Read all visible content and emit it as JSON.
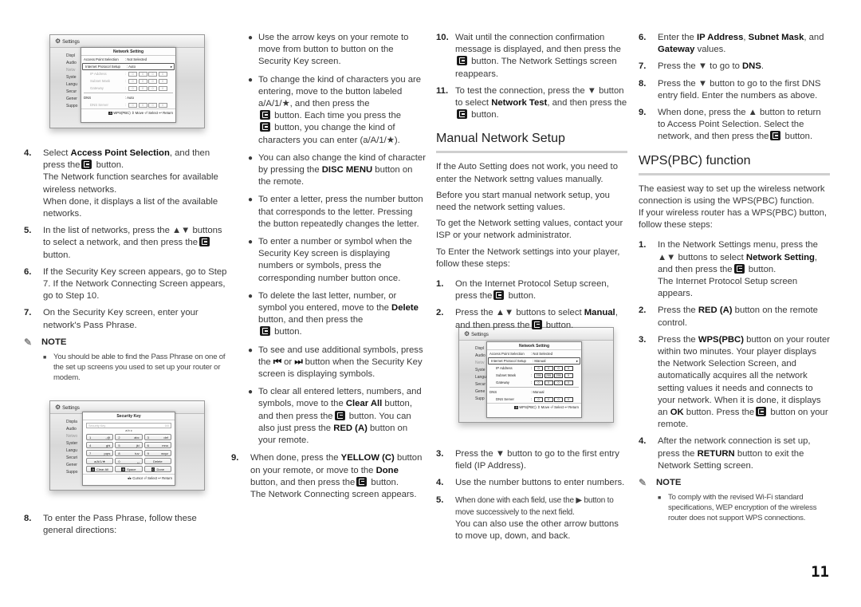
{
  "page_number": "11",
  "enter_icon": "enter-button-icon",
  "screen1": {
    "header": "Settings",
    "sidebar": [
      "Displ",
      "Audio",
      "Netw",
      "Syste",
      "Langu",
      "Secur",
      "Gener",
      "Suppo"
    ],
    "popup_title": "Network Setting",
    "rows": [
      {
        "label": "Access Point Selection",
        "value": ": Not Selected"
      },
      {
        "label": "Internet Protocol Setup",
        "value": ": Auto"
      }
    ],
    "ip_fields": [
      {
        "label": "IP Address",
        "cells": [
          "0",
          "0",
          "0",
          "0"
        ]
      },
      {
        "label": "Subnet Mask",
        "cells": [
          "0",
          "0",
          "0",
          "0"
        ]
      },
      {
        "label": "Gateway",
        "cells": [
          "0",
          "0",
          "0",
          "0"
        ]
      }
    ],
    "dns_label": "DNS",
    "dns_value": ": Auto",
    "dns_server": {
      "label": "DNS Server",
      "cells": [
        "0",
        "0",
        "0",
        "0"
      ]
    },
    "footer": {
      "key": "A",
      "text": "WPS(PBC)  ⇕ Move  ⏎ Select  ↩ Return"
    }
  },
  "screen2": {
    "header": "Settings",
    "sidebar": [
      "Displa",
      "Audio",
      "Netwo",
      "Syster",
      "Langu",
      "Securi",
      "Gener",
      "Suppo"
    ],
    "popup_title": "Security Key",
    "input_placeholder": "Security Key",
    "input_counter": "0/0",
    "charset": "a  b  c",
    "keys": [
      {
        "num": "1",
        "chars": ".,@"
      },
      {
        "num": "2",
        "chars": "abc"
      },
      {
        "num": "3",
        "chars": "def"
      },
      {
        "num": "4",
        "chars": "ghi"
      },
      {
        "num": "5",
        "chars": "jkl"
      },
      {
        "num": "6",
        "chars": "mno"
      },
      {
        "num": "7",
        "chars": "pqrs"
      },
      {
        "num": "8",
        "chars": "tuv"
      },
      {
        "num": "9",
        "chars": "wxyz"
      },
      {
        "num": "",
        "chars": "a/A/1/★"
      },
      {
        "num": "0",
        "chars": "␣"
      },
      {
        "num": "",
        "chars": "Delete"
      },
      {
        "num": "A",
        "chars": "Clear All"
      },
      {
        "num": "B",
        "chars": "Space"
      },
      {
        "num": "C",
        "chars": "Done"
      }
    ],
    "footer": "◂/▸ Cursor  ⏎ Select  ↩ Return"
  },
  "screen3": {
    "header": "Settings",
    "sidebar": [
      "Displ",
      "Audio",
      "Netw",
      "Syste",
      "Langu",
      "Secur",
      "Gene",
      "Supp"
    ],
    "popup_title": "Network Setting",
    "rows": [
      {
        "label": "Access Point Selection",
        "value": ": Not Selected"
      },
      {
        "label": "Internet Protocol Setup",
        "value": ": Manual"
      }
    ],
    "ip_fields": [
      {
        "label": "IP Address",
        "cells": [
          "0",
          "0",
          "0",
          "0"
        ]
      },
      {
        "label": "Subnet Mask",
        "cells": [
          "255",
          "255",
          "255",
          "0"
        ]
      },
      {
        "label": "Gateway",
        "cells": [
          "0",
          "0",
          "0",
          "0"
        ]
      }
    ],
    "dns_label": "DNS",
    "dns_value": ": Manual",
    "dns_server": {
      "label": "DNS Server",
      "cells": [
        "0",
        "0",
        "0",
        "0"
      ]
    },
    "footer": {
      "key": "A",
      "text": "WPS(PBC)  ⇕ Move  ⏎ Select  ↩ Return"
    }
  },
  "col1": {
    "step4": {
      "num": "4.",
      "pre": "Select ",
      "bold": "Access Point Selection",
      "post": ", and then press the",
      "post2": " button.",
      "line2": "The Network function searches for available wireless networks.",
      "line3": "When done, it displays a list of the available networks."
    },
    "step5": {
      "num": "5.",
      "pre": "In the list of networks, press the ▲▼ buttons to select a network, and then press the",
      "post": " button."
    },
    "step6": {
      "num": "6.",
      "text": "If the Security Key screen appears, go to Step 7. If the Network Connecting Screen appears, go to Step 10."
    },
    "step7": {
      "num": "7.",
      "text": "On the Security Key screen, enter your network's Pass Phrase."
    },
    "note_label": "NOTE",
    "note_text": "You should be able to find the Pass Phrase on one of the set up screens you used to set up your router or modem.",
    "step8": {
      "num": "8.",
      "text": "To enter the Pass Phrase, follow these general directions:"
    }
  },
  "col2": {
    "b1": "Use the arrow keys on your remote to move from button to button on the Security Key screen.",
    "b2": {
      "pre": "To change the kind of characters you are entering, move to the button labeled a/A/1/★, and then press the",
      "mid": " button. Each time you press the",
      "post": " button, you change the kind of characters you can enter (a/A/1/★)."
    },
    "b3": {
      "pre": "You can also change the kind of character by pressing the ",
      "bold": "DISC MENU",
      "post": " button on the remote."
    },
    "b4": "To enter a letter, press the number button that corresponds to the letter. Pressing the button repeatedly changes the letter.",
    "b5": "To enter a number or symbol when the Security Key screen is displaying numbers or symbols, press the corresponding number button once.",
    "b6": {
      "pre": "To delete the last letter, number, or symbol you entered, move to the ",
      "bold": "Delete",
      "mid": " button, and then press the",
      "post": " button."
    },
    "b7": {
      "pre": "To see and use additional symbols, press the ",
      "sym1": "⏮",
      "mid": " or ",
      "sym2": "⏭",
      "post": " button when the Security Key screen is displaying symbols."
    },
    "b8": {
      "pre": "To clear all entered letters, numbers, and symbols, move to the ",
      "bold": "Clear All",
      "mid": " button, and then press the",
      "mid2": " button. You can also just press the ",
      "bold2": "RED (A)",
      "post": " button on your remote."
    },
    "step9": {
      "num": "9.",
      "pre": "When done, press the ",
      "bold": "YELLOW (C)",
      "mid": " button on your remote, or move to the ",
      "bold2": "Done",
      "mid2": " button, and then press the",
      "post": " button.",
      "line2": "The Network Connecting screen appears."
    }
  },
  "col3": {
    "step10": {
      "num": "10.",
      "pre": "Wait until the connection confirmation message is displayed, and then press the",
      "post": " button. The Network Settings screen reappears."
    },
    "step11": {
      "num": "11.",
      "pre": "To test the connection, press the ▼ button to select ",
      "bold": "Network Test",
      "mid": ", and then press the",
      "post": " button."
    },
    "heading": "Manual Network Setup",
    "p1": "If the Auto Setting does not work, you need to enter the Network settng values manually.",
    "p2": "Before you start manual network setup, you need the network setting values.",
    "p3": "To get the Network setting values, contact your ISP or your network administrator.",
    "p4": "To Enter the Network settings into your player, follow these steps:",
    "step1": {
      "num": "1.",
      "pre": "On the Internet Protocol Setup screen, press the",
      "post": " button."
    },
    "step2": {
      "num": "2.",
      "pre": "Press the ▲▼ buttons to select ",
      "bold": "Manual",
      "mid": ", and then press the",
      "post": " button."
    },
    "step3": {
      "num": "3.",
      "text": "Press the ▼ button to go to the first entry field (IP Address)."
    },
    "step4": {
      "num": "4.",
      "text": "Use the number buttons to enter numbers."
    },
    "step5": {
      "num": "5.",
      "line1": "When done with each field, use the ▶ button to move successively to the next field.",
      "line2": "You can also use the other arrow buttons to move up, down, and back."
    }
  },
  "col4": {
    "step6": {
      "num": "6.",
      "pre": "Enter the ",
      "b1": "IP Address",
      "s1": ", ",
      "b2": "Subnet Mask",
      "s2": ", and ",
      "b3": "Gateway",
      "post": " values."
    },
    "step7": {
      "num": "7.",
      "pre": "Press the ▼ to go to ",
      "bold": "DNS",
      "post": "."
    },
    "step8": {
      "num": "8.",
      "text": "Press the ▼ button to go to the first DNS entry field. Enter the numbers as above."
    },
    "step9": {
      "num": "9.",
      "pre": "When done, press the ▲ button to return to Access Point Selection. Select the network, and then press the",
      "post": " button."
    },
    "heading": "WPS(PBC) function",
    "p1": "The easiest way to set up the wireless network connection is using the WPS(PBC) function.",
    "p2": "If your wireless router has a WPS(PBC) button, follow these steps:",
    "s1": {
      "num": "1.",
      "pre": "In the Network Settings menu, press the ▲▼ buttons to select ",
      "bold": "Network Setting",
      "mid": ", and then press the",
      "post": " button.",
      "line2": "The Internet Protocol Setup screen appears."
    },
    "s2": {
      "num": "2.",
      "pre": "Press the ",
      "bold": "RED (A)",
      "post": " button on the remote control."
    },
    "s3": {
      "num": "3.",
      "pre": "Press the ",
      "bold": "WPS(PBC)",
      "mid": " button on your router within two minutes. Your player displays the Network Selection Screen, and automatically acquires all the network setting values it needs and connects to your network. When it is done, it displays an ",
      "bold2": "OK",
      "mid2": " button. Press the",
      "post": " button on your remote."
    },
    "s4": {
      "num": "4.",
      "pre": "After the network connection is set up, press the ",
      "bold": "RETURN",
      "post": " button to exit the Network Setting screen."
    },
    "note_label": "NOTE",
    "note_text": "To comply with the revised Wi-Fi standard specifications, WEP encryption of the wireless router does not support WPS connections."
  }
}
